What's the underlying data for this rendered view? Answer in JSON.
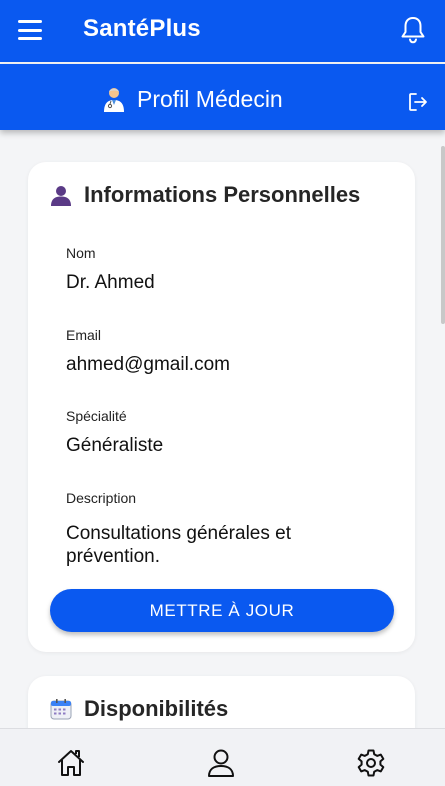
{
  "app": {
    "title": "SantéPlus"
  },
  "subheader": {
    "title": "Profil Médecin"
  },
  "personal_info": {
    "heading": "Informations Personnelles",
    "fields": [
      {
        "label": "Nom",
        "value": "Dr. Ahmed"
      },
      {
        "label": "Email",
        "value": "ahmed@gmail.com"
      },
      {
        "label": "Spécialité",
        "value": "Généraliste"
      },
      {
        "label": "Description",
        "value": "Consultations générales et prévention."
      }
    ],
    "update_label": "METTRE À JOUR"
  },
  "availability": {
    "heading": "Disponibilités"
  },
  "icons": {
    "menu": "hamburger-menu-icon",
    "notifications": "bell-icon",
    "doctor": "doctor-emoji-icon",
    "logout": "logout-icon",
    "person": "person-silhouette-icon",
    "calendar": "calendar-icon",
    "home": "home-icon",
    "profile": "user-icon",
    "settings": "gear-icon"
  },
  "colors": {
    "primary": "#0a59f0",
    "background": "#f4f5f7",
    "card": "#ffffff",
    "nav": "#f1f2f5"
  }
}
